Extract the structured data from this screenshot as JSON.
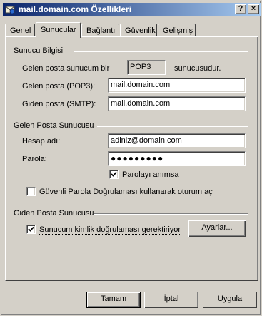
{
  "window": {
    "title": "mail.domain.com Özellikleri",
    "help_button": "?",
    "close_button": "×"
  },
  "tabs": [
    {
      "label": "Genel",
      "active": false
    },
    {
      "label": "Sunucular",
      "active": true
    },
    {
      "label": "Bağlantı",
      "active": false
    },
    {
      "label": "Güvenlik",
      "active": false
    },
    {
      "label": "Gelişmiş",
      "active": false
    }
  ],
  "server_info": {
    "group_title": "Sunucu Bilgisi",
    "incoming_type_prefix": "Gelen posta sunucum bir",
    "incoming_type_value": "POP3",
    "incoming_type_suffix": "sunucusudur.",
    "incoming_label": "Gelen posta (POP3):",
    "incoming_value": "mail.domain.com",
    "outgoing_label": "Giden posta (SMTP):",
    "outgoing_value": "mail.domain.com"
  },
  "incoming_server": {
    "group_title": "Gelen Posta Sunucusu",
    "account_label": "Hesap adı:",
    "account_value": "adiniz@domain.com",
    "password_label": "Parola:",
    "password_value": "●●●●●●●●●",
    "remember_label": "Parolayı anımsa",
    "remember_checked": true,
    "spa_label": "Güvenli Parola Doğrulaması kullanarak oturum aç",
    "spa_checked": false
  },
  "outgoing_server": {
    "group_title": "Giden Posta Sunucusu",
    "auth_label": "Sunucum kimlik doğrulaması gerektiriyor",
    "auth_checked": true,
    "settings_button": "Ayarlar..."
  },
  "footer": {
    "ok_button": "Tamam",
    "cancel_button": "İptal",
    "apply_button": "Uygula"
  },
  "colors": {
    "title_start": "#0a246a",
    "title_end": "#a6caf0",
    "face": "#d4d0c8"
  }
}
